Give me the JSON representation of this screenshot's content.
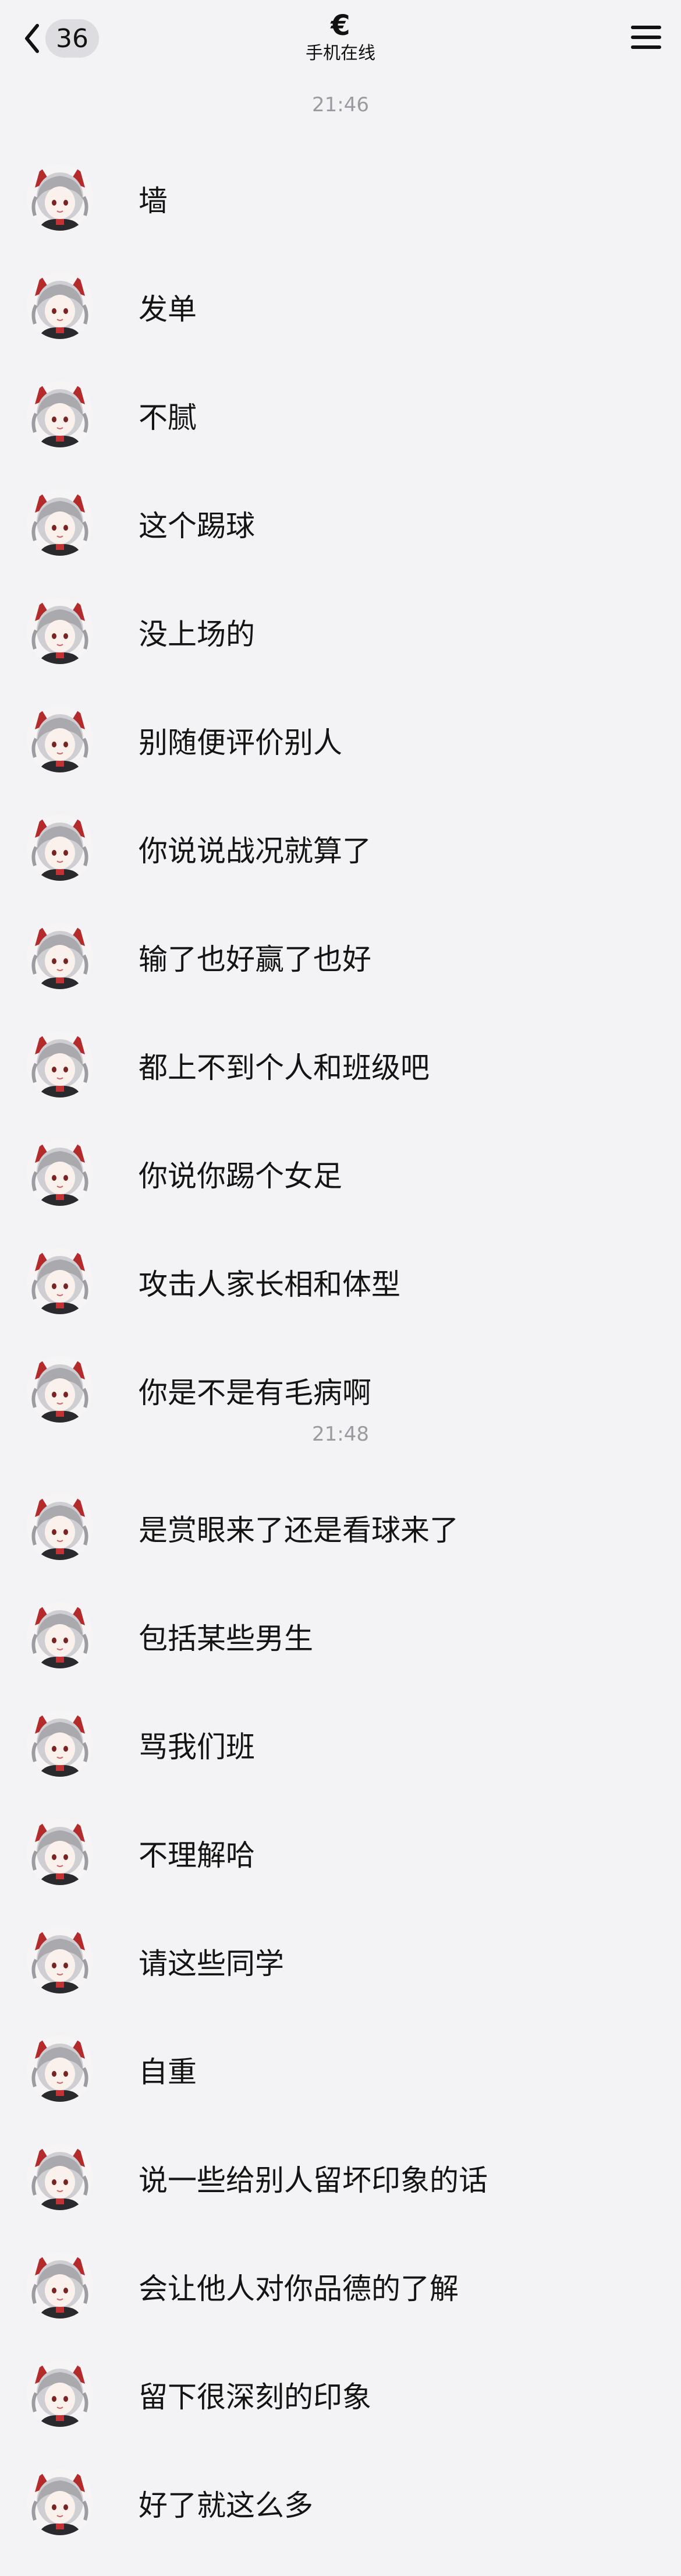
{
  "header": {
    "back_count": "36",
    "title": "€",
    "subtitle": "手机在线"
  },
  "chat": [
    {
      "kind": "time",
      "text": "21:46"
    },
    {
      "kind": "msg",
      "text": "墙"
    },
    {
      "kind": "msg",
      "text": "发单"
    },
    {
      "kind": "msg",
      "text": "不腻"
    },
    {
      "kind": "msg",
      "text": "这个踢球"
    },
    {
      "kind": "msg",
      "text": "没上场的"
    },
    {
      "kind": "msg",
      "text": "别随便评价别人"
    },
    {
      "kind": "msg",
      "text": "你说说战况就算了"
    },
    {
      "kind": "msg",
      "text": "输了也好赢了也好"
    },
    {
      "kind": "msg",
      "text": "都上不到个人和班级吧"
    },
    {
      "kind": "msg",
      "text": "你说你踢个女足"
    },
    {
      "kind": "msg",
      "text": "攻击人家长相和体型"
    },
    {
      "kind": "msg",
      "text": "你是不是有毛病啊"
    },
    {
      "kind": "time",
      "text": "21:48"
    },
    {
      "kind": "msg",
      "text": "是赏眼来了还是看球来了"
    },
    {
      "kind": "msg",
      "text": "包括某些男生"
    },
    {
      "kind": "msg",
      "text": "骂我们班"
    },
    {
      "kind": "msg",
      "text": "不理解哈"
    },
    {
      "kind": "msg",
      "text": "请这些同学"
    },
    {
      "kind": "msg",
      "text": "自重"
    },
    {
      "kind": "msg",
      "text": "说一些给别人留坏印象的话"
    },
    {
      "kind": "msg",
      "text": "会让他人对你品德的了解"
    },
    {
      "kind": "msg",
      "text": "留下很深刻的印象"
    },
    {
      "kind": "msg",
      "text": "好了就这么多"
    }
  ],
  "colors": {
    "background": "#f3f3f5",
    "timestamp": "#9a9aa0",
    "badge": "#dcdce1"
  }
}
